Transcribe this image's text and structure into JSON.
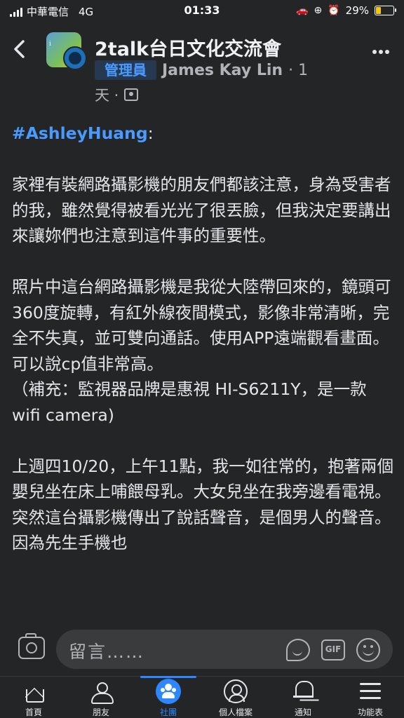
{
  "status_bar": {
    "carrier": "中華電信",
    "network": "4G",
    "time": "01:33",
    "battery": "29%",
    "battery_level": 0.29
  },
  "header": {
    "group_name": "2talk台日文化交流會",
    "admin_badge": "管理員",
    "author": "James Kay Lin",
    "time_ago_part1": "· 1",
    "time_ago_part2": "天 ·",
    "back_icon": "chevron-left-icon",
    "more_icon": "more-horizontal-icon"
  },
  "post": {
    "hashtag": "#AshleyHuang",
    "hashtag_suffix": ":",
    "paragraph1": "家裡有裝網路攝影機的朋友們都該注意，身為受害者的我，雖然覺得被看光光了很丟臉，但我決定要講出來讓妳們也注意到這件事的重要性。",
    "paragraph2": "照片中這台網路攝影機是我從大陸帶回來的，鏡頭可360度旋轉，有紅外線夜間模式，影像非常清晰，完全不失真，並可雙向通話。使用APP遠端觀看畫面。可以說cp值非常高。",
    "paragraph2b": "（補充：監視器品牌是惠視 HI-S6211Y，是一款 wifi camera)",
    "paragraph3": "上週四10/20，上午11點，我一如往常的，抱著兩個嬰兒坐在床上哺餵母乳。大女兒坐在我旁邊看電視。突然這台攝影機傳出了說話聲音，是個男人的聲音。因為先生手機也"
  },
  "comment_bar": {
    "placeholder": "留言……",
    "gif_label": "GIF"
  },
  "tabs": [
    {
      "label": "首頁",
      "icon": "home-icon",
      "active": false
    },
    {
      "label": "朋友",
      "icon": "friends-icon",
      "active": false
    },
    {
      "label": "社團",
      "icon": "groups-icon",
      "active": true
    },
    {
      "label": "個人檔案",
      "icon": "profile-icon",
      "active": false
    },
    {
      "label": "通知",
      "icon": "bell-icon",
      "active": false
    },
    {
      "label": "功能表",
      "icon": "menu-icon",
      "active": false
    }
  ],
  "colors": {
    "background": "#242526",
    "accent": "#2d88ff",
    "hashtag": "#4a9bff",
    "text": "#e4e6eb",
    "muted": "#b0b3b8"
  }
}
